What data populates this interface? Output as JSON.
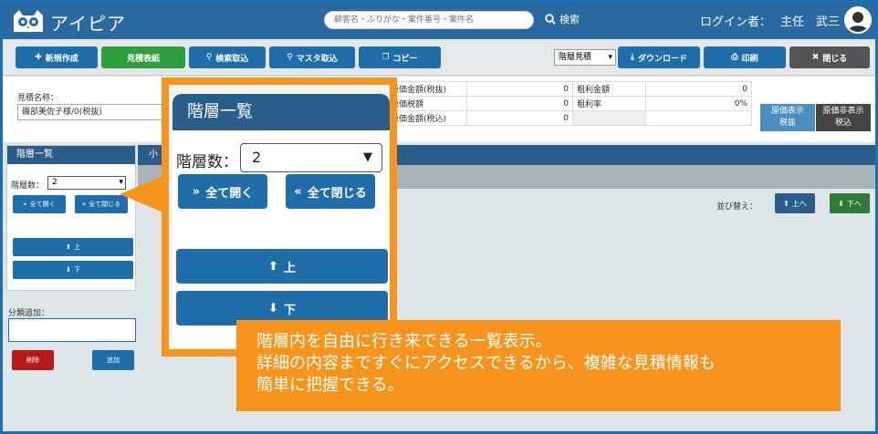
{
  "header": {
    "app_name": "アイピア",
    "search_placeholder": "顧客名・ふりがな・案件番号・案件名",
    "search_label": "検索",
    "login_label": "ログイン者：",
    "user_role": "主任　武三"
  },
  "toolbar": {
    "new": "新規作成",
    "estimate_sheet": "見積表紙",
    "search_import": "検索取込",
    "master_import": "マスタ取込",
    "copy": "コピー",
    "level_select": "階層見積",
    "download": "ダウンロード",
    "print": "印刷",
    "close": "閉じる"
  },
  "info": {
    "quote_name_label": "見積名称：",
    "quote_name_value": "磯部美佐子様/0(税抜)",
    "rows": [
      {
        "label": "原価金額(税抜)",
        "value": "0",
        "label2": "粗利金額",
        "value2": "0"
      },
      {
        "label": "原価税額",
        "value": "0",
        "label2": "粗利率",
        "value2": "0%"
      },
      {
        "label": "原価金額(税込)",
        "value": "0",
        "label2": "",
        "value2": ""
      }
    ],
    "cost_show": "原価表示",
    "cost_show_sub": "税抜",
    "cost_hide": "原価非表示",
    "cost_hide_sub": "税込"
  },
  "left_panel": {
    "title": "階層一覧",
    "level_label": "階層数：",
    "level_value": "2",
    "expand_all": "全て開く",
    "collapse_all": "全て閉じる",
    "up": "上",
    "down": "下",
    "category_label": "分類追加：",
    "delete": "削除",
    "add": "追加"
  },
  "right_panel": {
    "header": "小",
    "sort_label": "並び替え：",
    "sort_up": "上へ",
    "sort_down": "下へ"
  },
  "zoom": {
    "title": "階層一覧",
    "level_label": "階層数：",
    "level_value": "2",
    "expand_all": "全て開く",
    "collapse_all": "全て閉じる",
    "up": "上",
    "down": "下"
  },
  "caption": {
    "line1": "階層内を自由に行き来できる一覧表示。",
    "line2": "詳細の内容まですぐにアクセスできるから、複雑な見積情報も",
    "line3": "簡単に把握できる。"
  },
  "colors": {
    "header_bg": "#2a6aa0",
    "button_blue": "#1f6eaa",
    "button_green": "#2f9e3d",
    "button_dark": "#555555",
    "button_red": "#b71c1c",
    "panel_header": "#2a5d8a",
    "callout_orange": "#f7941d"
  }
}
